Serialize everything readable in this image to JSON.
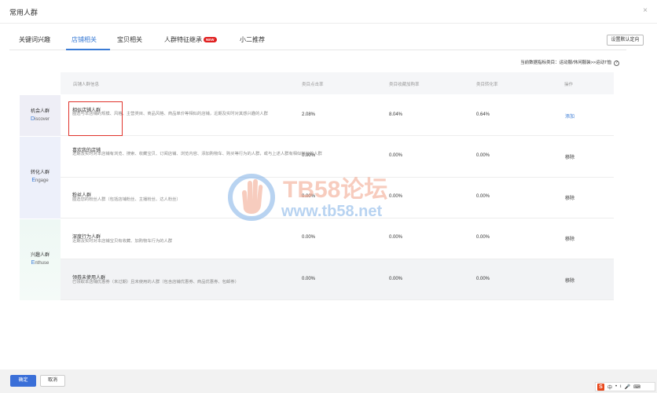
{
  "modal": {
    "title": "常用人群",
    "close_glyph": "×"
  },
  "tabs": [
    {
      "label": "关键词兴趣"
    },
    {
      "label": "店铺相关"
    },
    {
      "label": "宝贝相关"
    },
    {
      "label": "人群特征继承",
      "badge": "NEW"
    },
    {
      "label": "小二推荐"
    }
  ],
  "active_tab": "店铺相关",
  "settings_button": "设置默认定向",
  "category_note": "当前数据指标类目：运动服/休闲服装>>运动T恤",
  "help_glyph": "?",
  "table": {
    "headers": [
      "店铺人群信息",
      "类目点击率",
      "类目收藏加购率",
      "类目转化率",
      "操作"
    ],
    "segments": [
      {
        "cn": "机会人群",
        "en_first": "D",
        "en_rest": "iscover"
      },
      {
        "cn": "转化人群",
        "en_first": "E",
        "en_rest": "ngage"
      },
      {
        "cn": "兴趣人群",
        "en_first": "E",
        "en_rest": "nthuse"
      }
    ],
    "rows": [
      {
        "name": "相似店铺人群",
        "desc": "圈选与本店铺的规模、风格、主营类目、商品风格、商品单价等相似的店铺，近期及实时对其感兴趣的人群",
        "ctr": "2.08%",
        "fav": "8.04%",
        "cvr": "0.64%",
        "action": "添加"
      },
      {
        "name": "喜欢我的店铺",
        "desc": "近期及实时对本店铺有浏览、搜索、收藏宝贝、订阅店铺、浏览内容、添加购物车、购买等行为的人群，或与上述人群有相似特征的人群",
        "ctr": "0.00%",
        "fav": "0.00%",
        "cvr": "0.00%",
        "action": "移除"
      },
      {
        "name": "粉丝人群",
        "desc": "圈选您的粉丝人群（包括店铺粉丝、主播粉丝、达人粉丝）",
        "ctr": "0.00%",
        "fav": "0.00%",
        "cvr": "0.00%",
        "action": "移除"
      },
      {
        "name": "深度行为人群",
        "desc": "近期及实时对本店铺宝贝有收藏、加购物车行为的人群",
        "ctr": "0.00%",
        "fav": "0.00%",
        "cvr": "0.00%",
        "action": "移除"
      },
      {
        "name": "领券未使用人群",
        "desc": "已领取本店铺优惠券（未过期）且未使用的人群（包含店铺优惠券、商品优惠券、包邮券）",
        "ctr": "0.00%",
        "fav": "0.00%",
        "cvr": "0.00%",
        "action": "移除"
      }
    ]
  },
  "watermark": {
    "line1": "TB58论坛",
    "line2": "www.tb58.net"
  },
  "footer": {
    "ok": "确定",
    "cancel": "取消"
  },
  "ime": {
    "logo": "S",
    "items": [
      "中",
      "•",
      "ι",
      "🎤",
      "⌨"
    ]
  },
  "colors": {
    "accent": "#3a7bd5",
    "primary_button": "#3a6fd8",
    "highlight": "#e0332c",
    "new_badge": "#e02020"
  }
}
